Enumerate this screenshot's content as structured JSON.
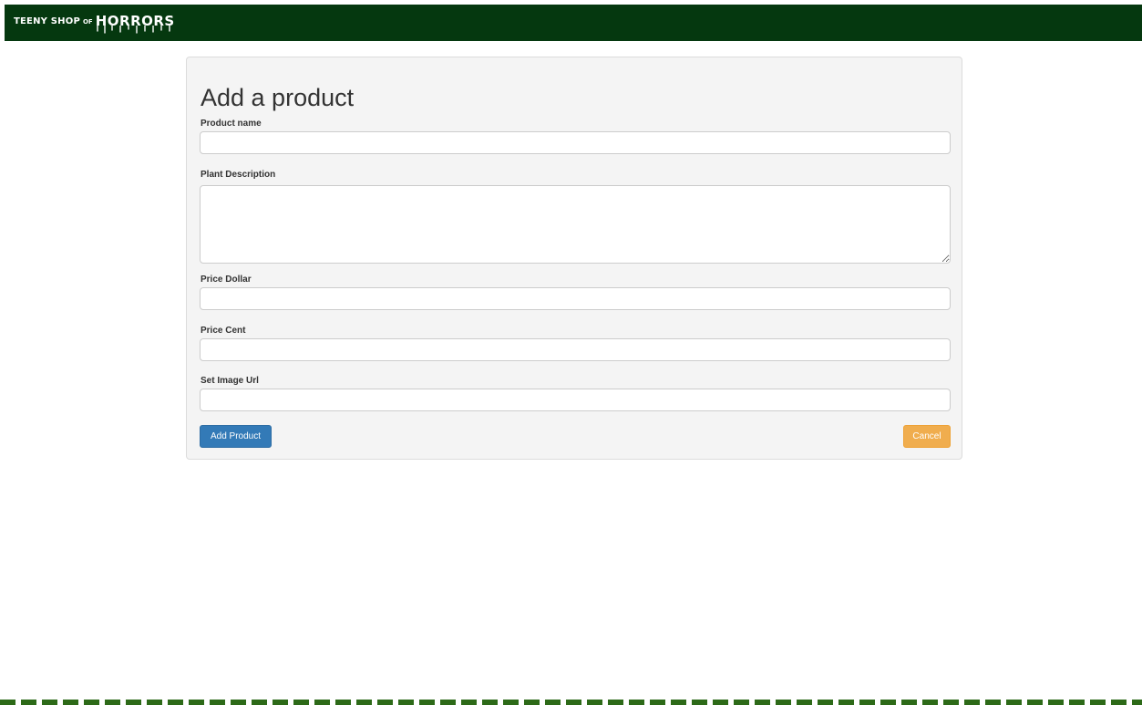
{
  "brand": {
    "teeny": "TEENY SHOP",
    "of": "OF",
    "horrors": "HORRORS"
  },
  "form": {
    "title": "Add a product",
    "fields": {
      "product_name": {
        "label": "Product name",
        "value": "",
        "placeholder": ""
      },
      "description": {
        "label": "Plant Description",
        "value": "",
        "placeholder": ""
      },
      "price_dollar": {
        "label": "Price Dollar",
        "value": "",
        "placeholder": ""
      },
      "price_cent": {
        "label": "Price Cent",
        "value": "",
        "placeholder": ""
      },
      "image_url": {
        "label": "Set Image Url",
        "value": "",
        "placeholder": ""
      }
    },
    "submit_label": "Add Product",
    "cancel_label": "Cancel"
  },
  "colors": {
    "header_bg": "#05380f",
    "primary": "#337ab7",
    "warning": "#f0ad4e",
    "footer_stripe": "#2d6a18"
  }
}
